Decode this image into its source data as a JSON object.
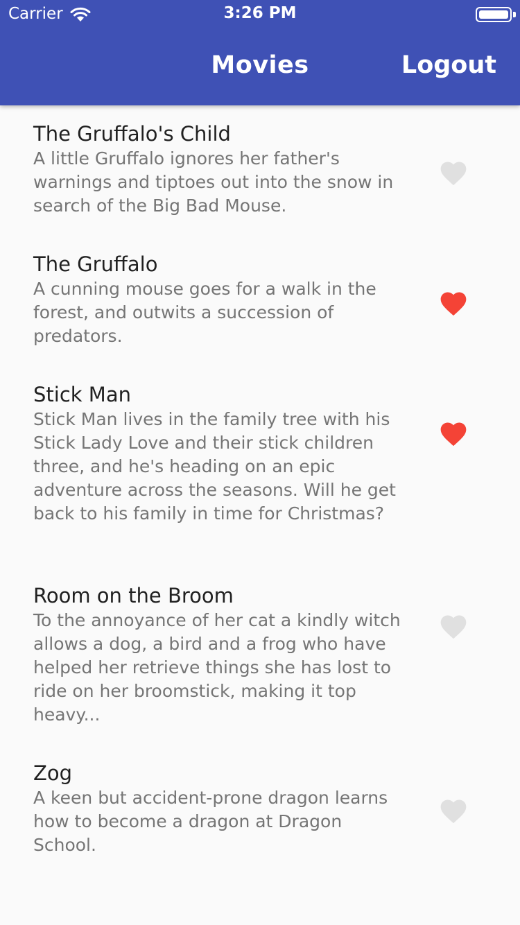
{
  "status_bar": {
    "carrier": "Carrier",
    "wifi_icon": "wifi-icon",
    "time": "3:26 PM",
    "battery_icon": "battery-icon"
  },
  "app_bar": {
    "title": "Movies",
    "logout_label": "Logout",
    "background": "#3f51b5"
  },
  "movies": [
    {
      "title": "The Gruffalo's Child",
      "description": "A little Gruffalo ignores her father's warnings and tiptoes out into the snow in search of the Big Bad Mouse.",
      "favorite": false
    },
    {
      "title": "The Gruffalo",
      "description": "A cunning mouse goes for a walk in the forest, and outwits a succession of predators.",
      "favorite": true
    },
    {
      "title": "Stick Man",
      "description": "Stick Man lives in the family tree with his Stick Lady Love and their stick children three, and he's heading on an epic adventure across the seasons. Will he get back to his family in time for Christmas?",
      "favorite": true
    },
    {
      "title": "Room on the Broom",
      "description": "To the annoyance of her cat a kindly witch allows a dog, a bird and a frog who have helped her retrieve things she has lost to ride on her broomstick, making it top heavy...",
      "favorite": false
    },
    {
      "title": "Zog",
      "description": "A keen but accident-prone dragon learns how to become a dragon at Dragon School.",
      "favorite": false
    }
  ],
  "colors": {
    "favorite_on": "#f44336",
    "favorite_off": "#e0e0e0"
  }
}
